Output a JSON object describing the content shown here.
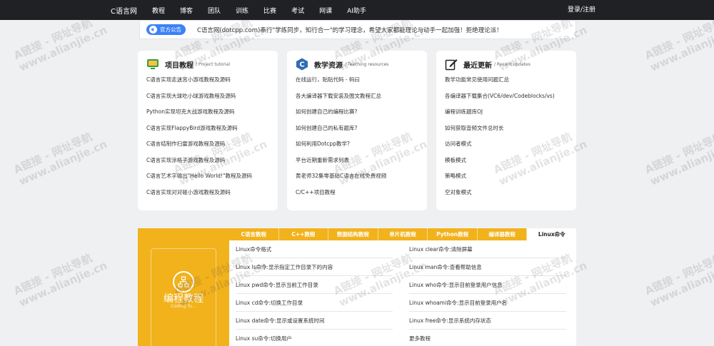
{
  "nav": {
    "brand": "C语言网",
    "items": [
      "教程",
      "博客",
      "团队",
      "训练",
      "比赛",
      "考试",
      "网课",
      "AI助手"
    ],
    "login": "登录/注册"
  },
  "announcement": {
    "badge": "官方公告",
    "text": "C语言网(dotcpp.com)奉行\"学练同步，知行合一\"的学习理念，希望大家都能理论与动手一起加强！拒绝理论派！"
  },
  "cards": [
    {
      "title": "项目教程",
      "subtitle": "/ Project tutorial",
      "icon": "monitor-icon",
      "items": [
        "C语言实现走迷宫小游戏教程及源码",
        "C语言实现大球吃小球游戏教程及源码",
        "Python实现坦克大战游戏教程及源码",
        "C语言实现FlappyBird游戏教程及源码",
        "C语言结制作扫雷游戏教程及源码",
        "C语言实现涂格子游戏教程及源码",
        "C语言艺术字输出\"Hello World!\"教程及源码",
        "C语言实现对对碰小游戏教程及源码"
      ]
    },
    {
      "title": "教学资源",
      "subtitle": "/ Teaching resources",
      "icon": "c-logo-icon",
      "items": [
        "在线运行，贴贴代码 - 码曰",
        "各大编译器下载安装及图文教程汇总",
        "如何创建自己的编程比赛?",
        "如何创建自己的私有题库?",
        "如何利用Dotcpp教学?",
        "平台近期重新需求列表",
        "黄老师32集零基础C语言在线免费视频",
        "C/C++项目教程"
      ]
    },
    {
      "title": "最近更新",
      "subtitle": "/ Recent updates",
      "icon": "edit-icon",
      "items": [
        "教学功能常见使用问题汇总",
        "各编译器下载集合(VC6/dev/Codeblocks/vs)",
        "编程训练题库OJ",
        "如何获取音频文件总时长",
        "访问者模式",
        "模板模式",
        "策略模式",
        "空对象模式"
      ]
    }
  ],
  "promo": {
    "title": "编程教程",
    "subtitle": "Coding Tu..."
  },
  "tabs": [
    "C语言教程",
    "C++教程",
    "数据结构教程",
    "单片机教程",
    "Python教程",
    "编译器教程",
    "Linux命令"
  ],
  "commands": {
    "left": [
      "Linux命令格式",
      "Linux ls命令:显示指定工作目录下的内容",
      "Linux pwd命令:显示当前工作目录",
      "Linux cd命令:切换工作目录",
      "Linux date命令:显示或设置系统时间",
      "Linux su命令:切换用户"
    ],
    "right": [
      "Linux clear命令:清除屏幕",
      "Linux man命令:查看帮助信息",
      "Linux who命令:显示目前登录用户信息",
      "Linux whoami命令:显示目前登录用户名",
      "Linux free命令:显示系统内存状态",
      "更多教程"
    ]
  },
  "watermark": {
    "line1": "A链接 - 网址导航",
    "line2": "www.alianjie.cn"
  }
}
